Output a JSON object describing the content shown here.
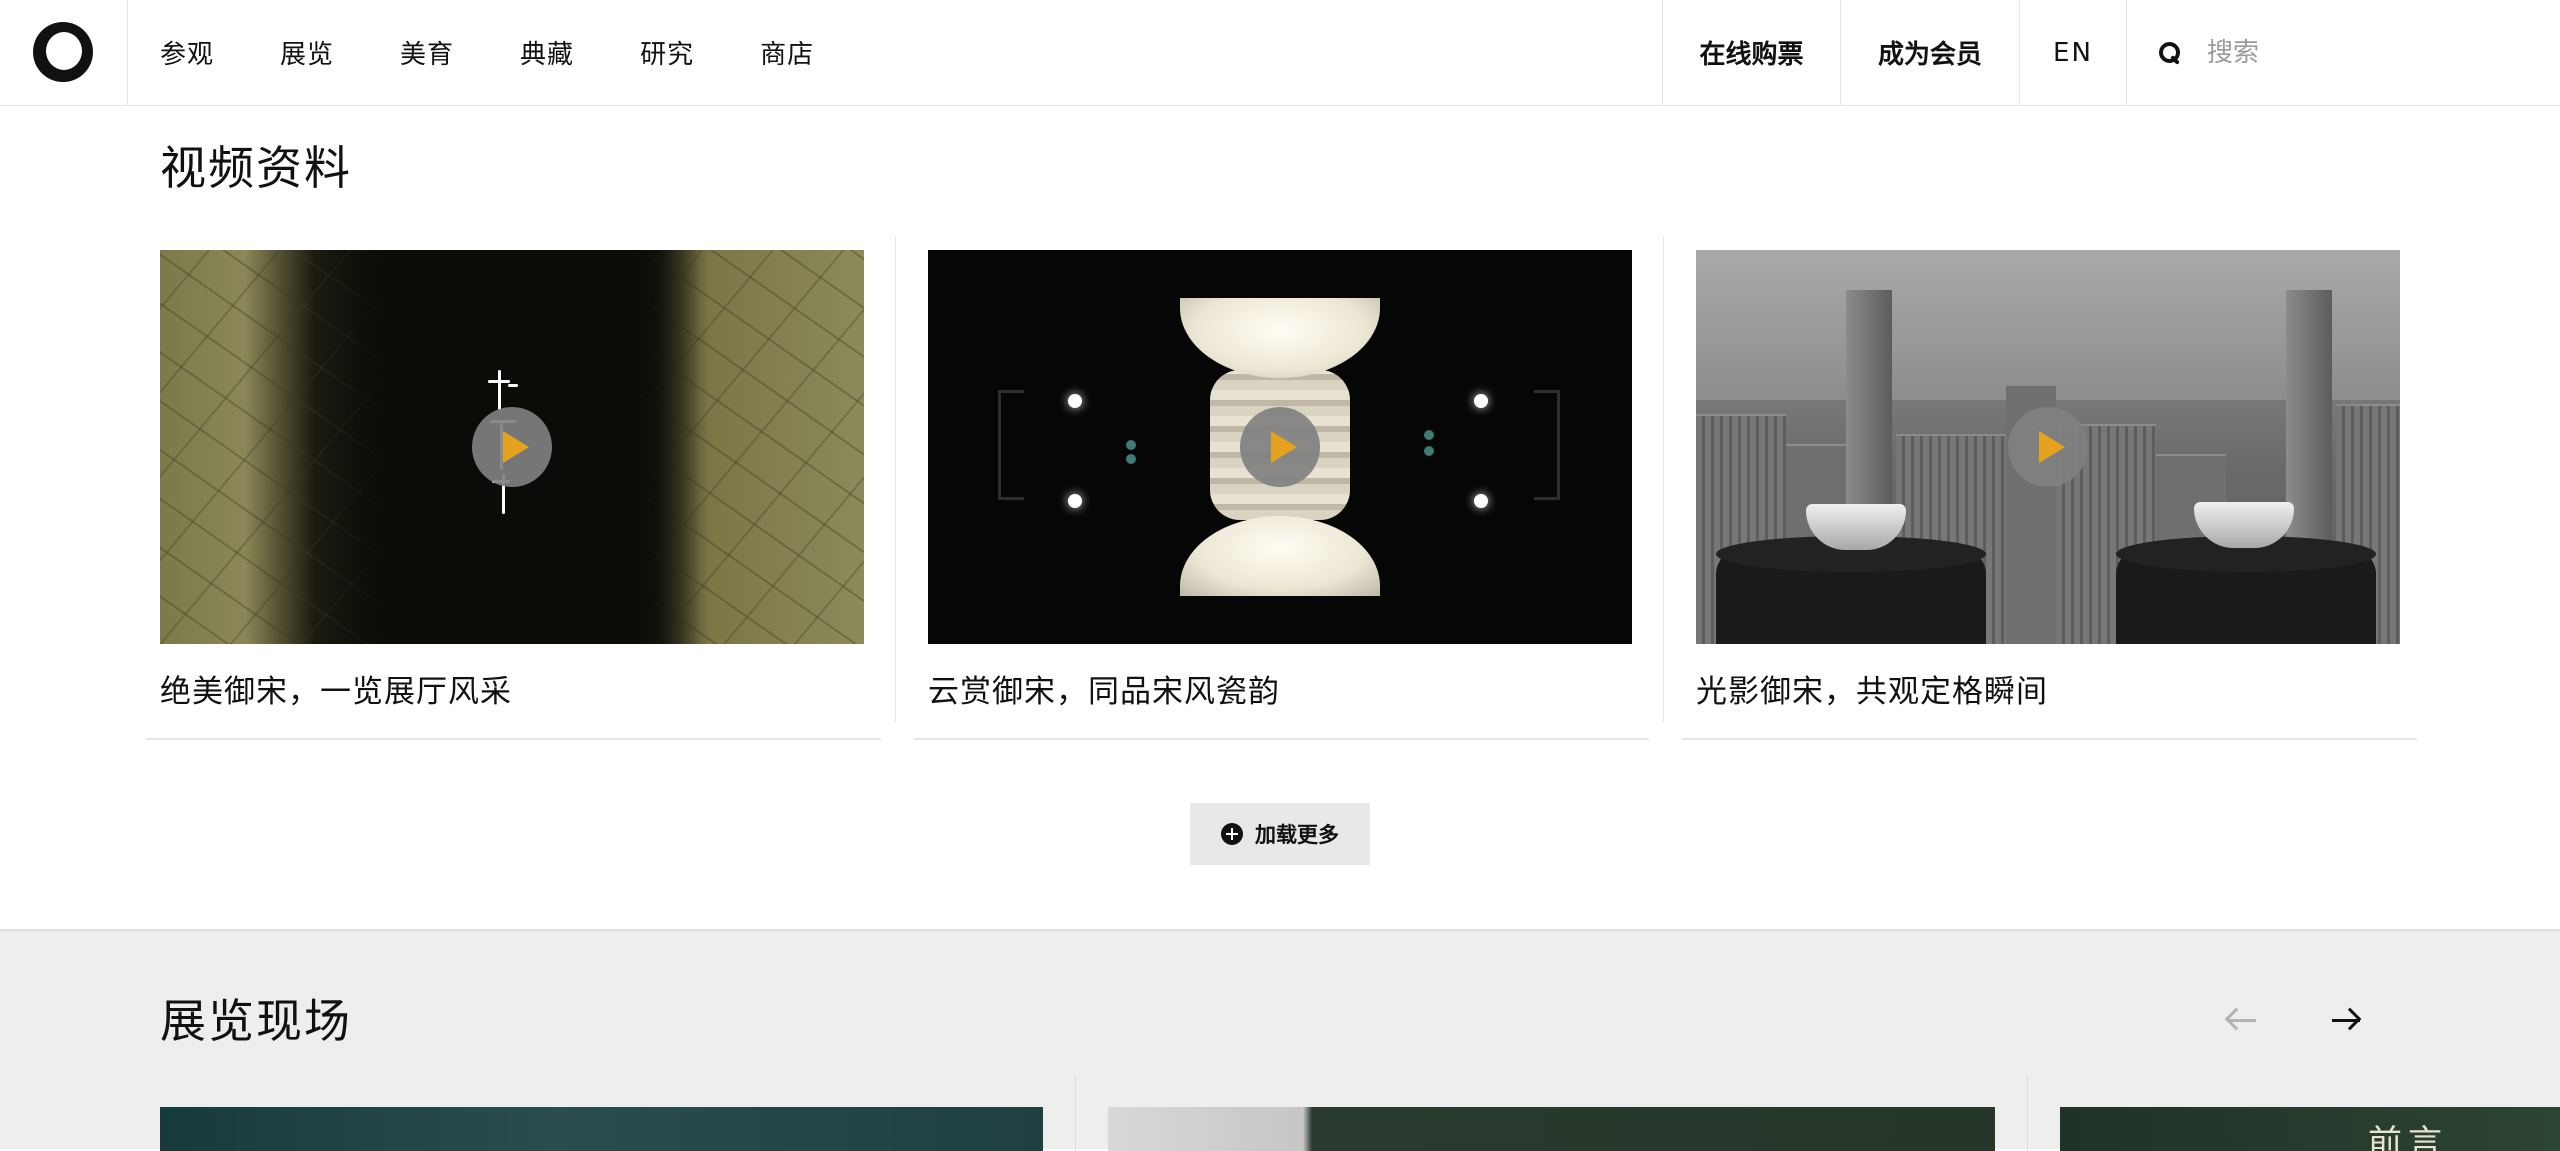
{
  "header": {
    "logo_label": "",
    "nav": [
      "参观",
      "展览",
      "美育",
      "典藏",
      "研究",
      "商店"
    ],
    "buy_ticket": "在线购票",
    "membership": "成为会员",
    "language": "EN",
    "search_placeholder": "搜索"
  },
  "videos": {
    "title": "视频资料",
    "items": [
      {
        "caption": "绝美御宋，一览展厅风采",
        "thumb": "celadon-crackle"
      },
      {
        "caption": "云赏御宋，同品宋风瓷韵",
        "thumb": "white-jade-cups"
      },
      {
        "caption": "光影御宋，共观定格瞬间",
        "thumb": "city-bowls"
      }
    ],
    "load_more": "加载更多"
  },
  "exhibition": {
    "title": "展览现场",
    "card3_text": "前言"
  },
  "colors": {
    "play_triangle": "#e5a21e",
    "section_bg": "#eeeeee",
    "load_more_bg": "#e8e8e8"
  }
}
